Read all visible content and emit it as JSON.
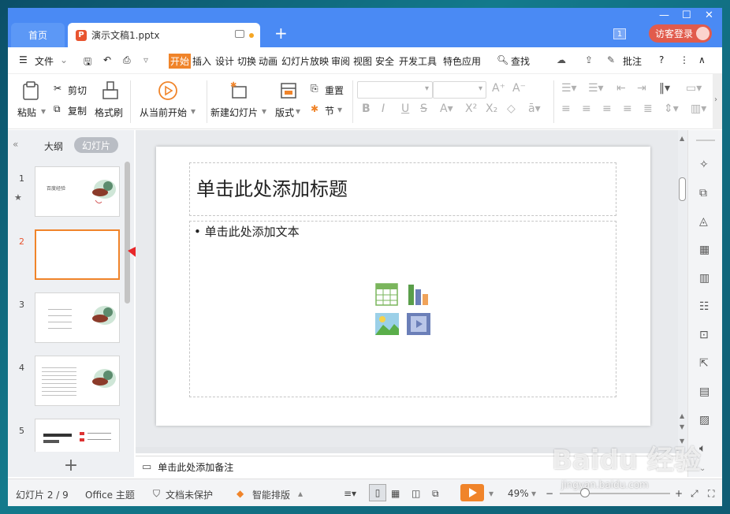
{
  "titlebar": {
    "home_tab": "首页",
    "doc_tab": "演示文稿1.pptx",
    "doc_icon_letter": "P",
    "page_badge": "1",
    "login_label": "访客登录",
    "accent": "#4a8af4"
  },
  "menubar": {
    "file": "文件",
    "tabs": [
      "开始",
      "插入",
      "设计",
      "切换",
      "动画",
      "幻灯片放映",
      "审阅",
      "视图",
      "安全",
      "开发工具",
      "特色应用"
    ],
    "active_tab": "开始",
    "search": "查找",
    "annotate": "批注",
    "active_color": "#f0842a"
  },
  "ribbon": {
    "paste": "粘贴",
    "cut": "剪切",
    "copy": "复制",
    "format_painter": "格式刷",
    "from_current": "从当前开始",
    "new_slide": "新建幻灯片",
    "layout": "版式",
    "reset": "重置",
    "section": "节"
  },
  "left_panel": {
    "outline_tab": "大纲",
    "slides_tab": "幻灯片",
    "slide_numbers": [
      "1",
      "2",
      "3",
      "4",
      "5"
    ],
    "slide1_title": "百度经验",
    "add_icon": "plus-icon"
  },
  "slide": {
    "title_placeholder": "单击此处添加标题",
    "body_placeholder": "• 单击此处添加文本"
  },
  "notes": {
    "placeholder": "单击此处添加备注"
  },
  "status": {
    "slide_count": "幻灯片 2 / 9",
    "theme": "Office 主题",
    "protect": "文档未保护",
    "smart_layout": "智能排版",
    "zoom": "49%"
  },
  "watermark": {
    "brand": "Baidu 经验",
    "url": "jingyan.baidu.com"
  }
}
